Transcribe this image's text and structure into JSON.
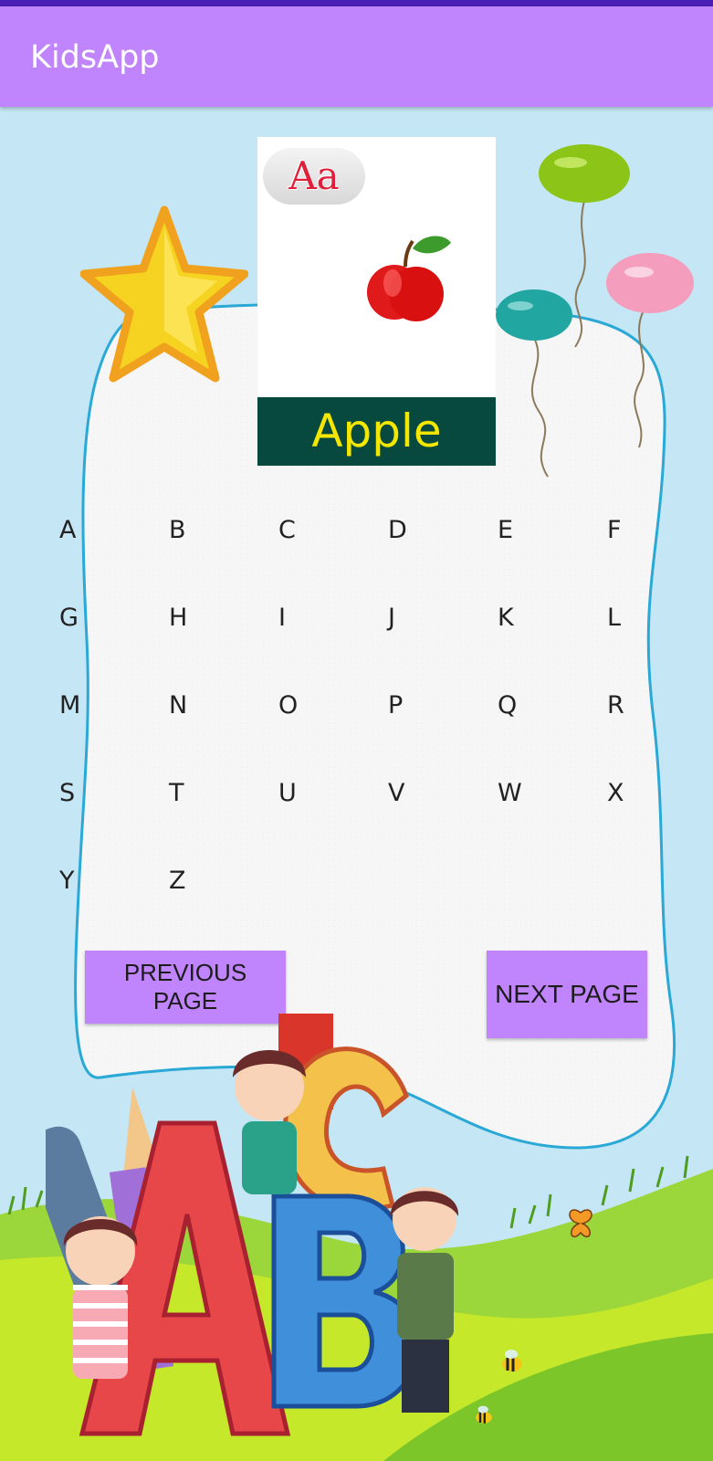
{
  "status_bar": {
    "color": "#4a1fb5"
  },
  "app_bar": {
    "title": "KidsApp",
    "color": "#c084fc"
  },
  "flashcard": {
    "case_label": "Aa",
    "word": "Apple",
    "image": "apple-icon",
    "footer_color": "#07493f",
    "word_color": "#f3e600"
  },
  "alphabet": {
    "letters": [
      "A",
      "B",
      "C",
      "D",
      "E",
      "F",
      "G",
      "H",
      "I",
      "J",
      "K",
      "L",
      "M",
      "N",
      "O",
      "P",
      "Q",
      "R",
      "S",
      "T",
      "U",
      "V",
      "W",
      "X",
      "Y",
      "Z"
    ]
  },
  "buttons": {
    "previous_label": "PREVIOUS PAGE",
    "next_label": "NEXT PAGE"
  },
  "decorations": [
    "star-icon",
    "balloons-icon",
    "grass-hill",
    "abc-kids-illustration",
    "butterfly-icon",
    "bee-icon"
  ]
}
